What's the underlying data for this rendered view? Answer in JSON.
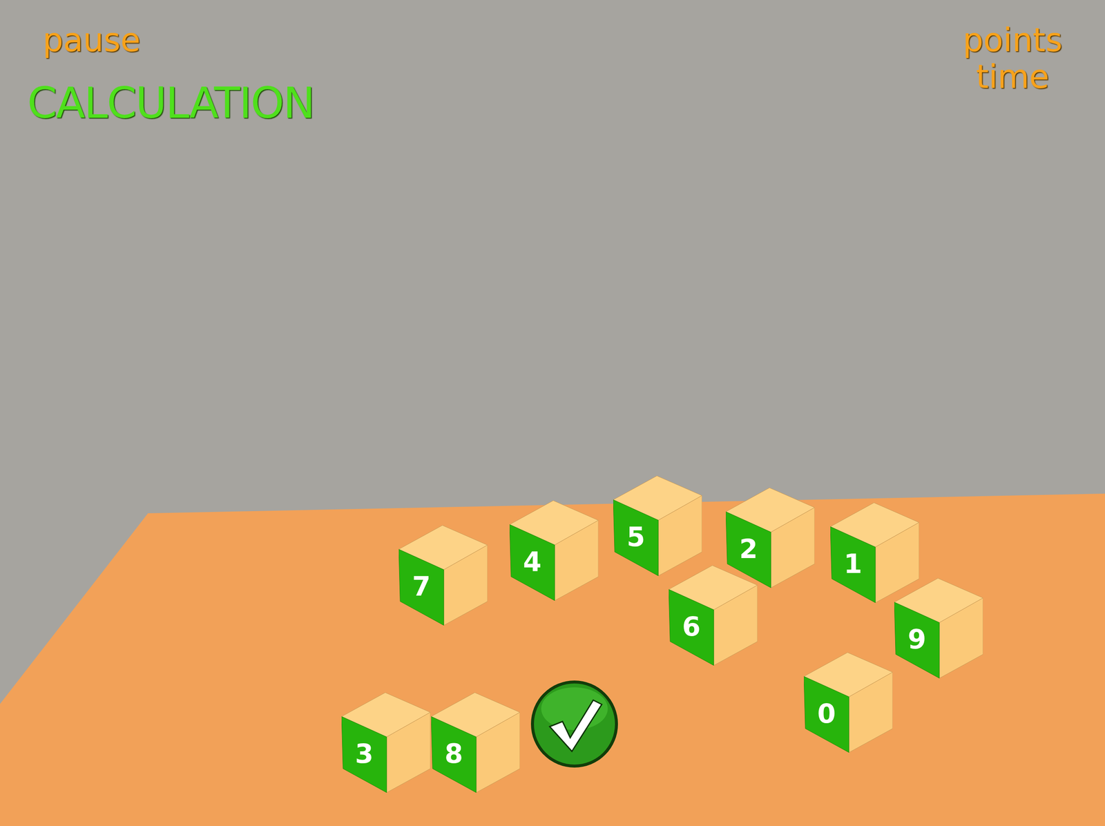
{
  "hud": {
    "pause": "pause",
    "mode": "CALCULATION",
    "points": "points",
    "time": "time"
  },
  "cubes": [
    {
      "label": "7"
    },
    {
      "label": "4"
    },
    {
      "label": "5"
    },
    {
      "label": "2"
    },
    {
      "label": "1"
    },
    {
      "label": "6"
    },
    {
      "label": "9"
    },
    {
      "label": "0"
    }
  ],
  "answer": [
    {
      "label": "3"
    },
    {
      "label": "8"
    }
  ],
  "submit": {
    "kind": "check"
  }
}
